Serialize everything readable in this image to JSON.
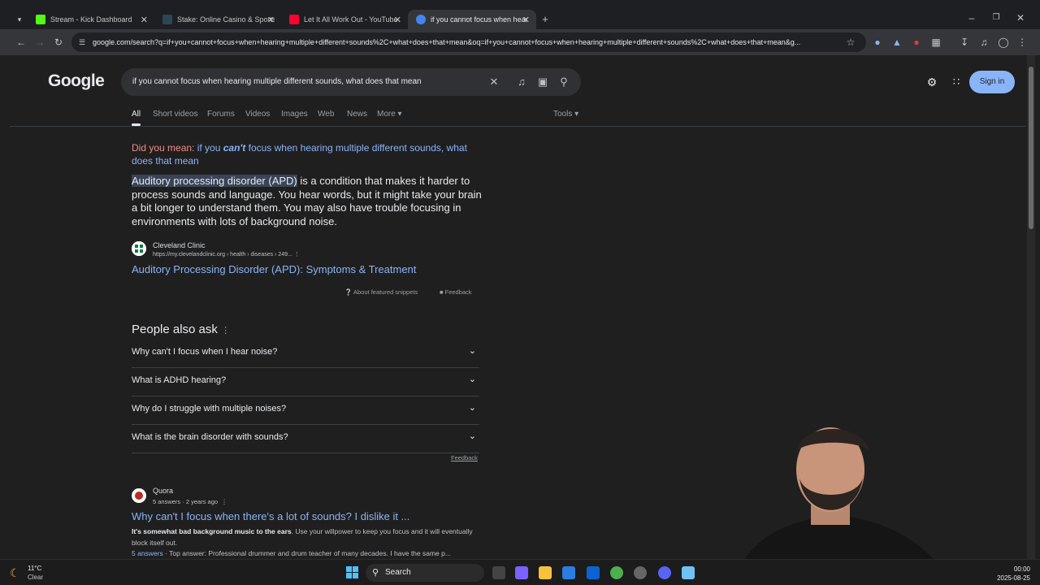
{
  "browser": {
    "tabs": [
      {
        "title": "Stream - Kick Dashboard",
        "color": "#53fc18"
      },
      {
        "title": "Stake: Online Casino & Sports B",
        "color": "#e8eaed"
      },
      {
        "title": "Let It All Work Out - YouTube",
        "color": "#ff0033"
      },
      {
        "title": "if you cannot focus when hearin",
        "color": "#4285f4"
      }
    ],
    "url": "google.com/search?q=if+you+cannot+focus+when+hearing+multiple+different+sounds%2C+what+does+that+mean&oq=if+you+cannot+focus+when+hearing+multiple+different+sounds%2C+what+does+that+mean&g..."
  },
  "google": {
    "logo": "Google",
    "query": "if you cannot focus when hearing multiple different sounds, what does that mean",
    "signin": "Sign in",
    "nav": [
      "All",
      "Short videos",
      "Forums",
      "Videos",
      "Images",
      "Web",
      "News",
      "More ▾"
    ],
    "tools": "Tools ▾"
  },
  "did_you_mean": {
    "label": "Did you mean:",
    "pre": "if you",
    "emph": "can't",
    "post": "focus when hearing multiple different sounds, what does that mean"
  },
  "snippet": {
    "highlight": "Auditory processing disorder (APD)",
    "text": "is a condition that makes it harder to process sounds and language. You hear words, but it might take your brain a bit longer to understand them. You may also have trouble focusing in environments with lots of background noise.",
    "source_name": "Cleveland Clinic",
    "source_url": "https://my.clevelandclinic.org › health › diseases › 249...",
    "link": "Auditory Processing Disorder (APD): Symptoms & Treatment",
    "about": "About featured snippets",
    "feedback": "Feedback"
  },
  "paa": {
    "title": "People also ask",
    "questions": [
      "Why can't I focus when I hear noise?",
      "What is ADHD hearing?",
      "Why do I struggle with multiple noises?",
      "What is the brain disorder with sounds?"
    ],
    "feedback": "Feedback"
  },
  "result2": {
    "source": "Quora",
    "meta": "5 answers · 2 years ago",
    "title": "Why can't I focus when there's a lot of sounds? I dislike it ...",
    "bold": "It's somewhat bad background music to the ears",
    "text": ". Use your willpower to keep you focus and it will eventually block itself out.",
    "more_link": "5 answers",
    "more_text": "· Top answer: Professional drummer and drum teacher of many decades. I have the same p..."
  },
  "taskbar": {
    "temp": "11°C",
    "condition": "Clear",
    "search": "Search",
    "time": "00:00",
    "date": "2025-08-25"
  }
}
